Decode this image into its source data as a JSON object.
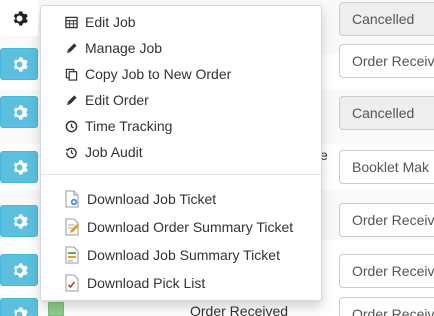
{
  "rows": [
    {
      "status": "Cancelled",
      "disabled": true
    },
    {
      "status": "Order Receiv",
      "disabled": false
    },
    {
      "status": "Cancelled",
      "disabled": true
    },
    {
      "status": "Booklet Mak",
      "disabled": false
    },
    {
      "status": "Order Receiv",
      "disabled": false
    },
    {
      "status": "Order Receiv",
      "disabled": false
    },
    {
      "status": "Order Receiv",
      "disabled": false
    }
  ],
  "behind": {
    "row4_fragment": "e",
    "row7_status_text": "Order Received"
  },
  "menu": {
    "edit_job": "Edit Job",
    "manage_job": "Manage Job",
    "copy_job": "Copy Job to New Order",
    "edit_order": "Edit Order",
    "time_tracking": "Time Tracking",
    "job_audit": "Job Audit",
    "download_job_ticket": "Download Job Ticket",
    "download_order_summary": "Download Order Summary Ticket",
    "download_job_summary": "Download Job Summary Ticket",
    "download_pick_list": "Download Pick List"
  },
  "colors": {
    "gear_button": "#5bc0de",
    "disabled_status": "#eeeeee"
  },
  "icons": [
    "gear-icon",
    "table-icon",
    "pencil-icon",
    "copy-icon",
    "clock-icon",
    "history-icon",
    "document-icon"
  ]
}
